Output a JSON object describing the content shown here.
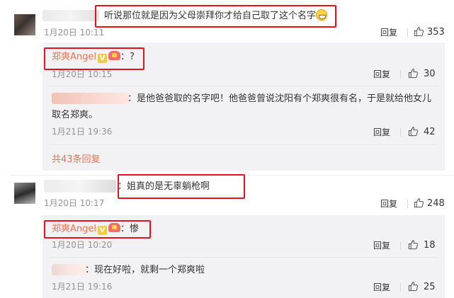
{
  "comments": [
    {
      "text": "听说那位就是因为父母崇拜你才给自己取了这个名字",
      "time": "1月20日 10:11",
      "reply_label": "回复",
      "likes": "353",
      "replies": [
        {
          "user": "郑爽Angel",
          "text": "：?",
          "time": "1月20日 10:15",
          "reply_label": "回复",
          "likes": "30"
        },
        {
          "text": "：是他爸爸取的名字吧！他爸爸曾说沈阳有个郑爽很有名，于是就给他女儿",
          "text2": "取名郑爽。",
          "time": "1月21日 19:36",
          "reply_label": "回复",
          "likes": "42"
        }
      ],
      "more_replies": "共43条回复"
    },
    {
      "text": "：姐真的是无辜躺枪啊",
      "time": "1月20日 10:17",
      "reply_label": "回复",
      "likes": "248",
      "replies": [
        {
          "user": "郑爽Angel",
          "text": "：惨",
          "time": "1月20日 10:20",
          "reply_label": "回复",
          "likes": "18"
        },
        {
          "text": "：现在好啦，就剩一个郑爽啦",
          "time": "1月21日 19:16",
          "reply_label": "回复",
          "likes": "25"
        }
      ]
    }
  ],
  "badges": {
    "verified": "V"
  },
  "icons": {
    "like": "thumbs-up-icon",
    "emoji": "grin-emoji-icon",
    "fan": "fan-badge-icon"
  },
  "colors": {
    "username": "#eb7350",
    "highlight_box": "#e3121b",
    "reply_bg": "#f2f2f5",
    "time": "#939393"
  }
}
